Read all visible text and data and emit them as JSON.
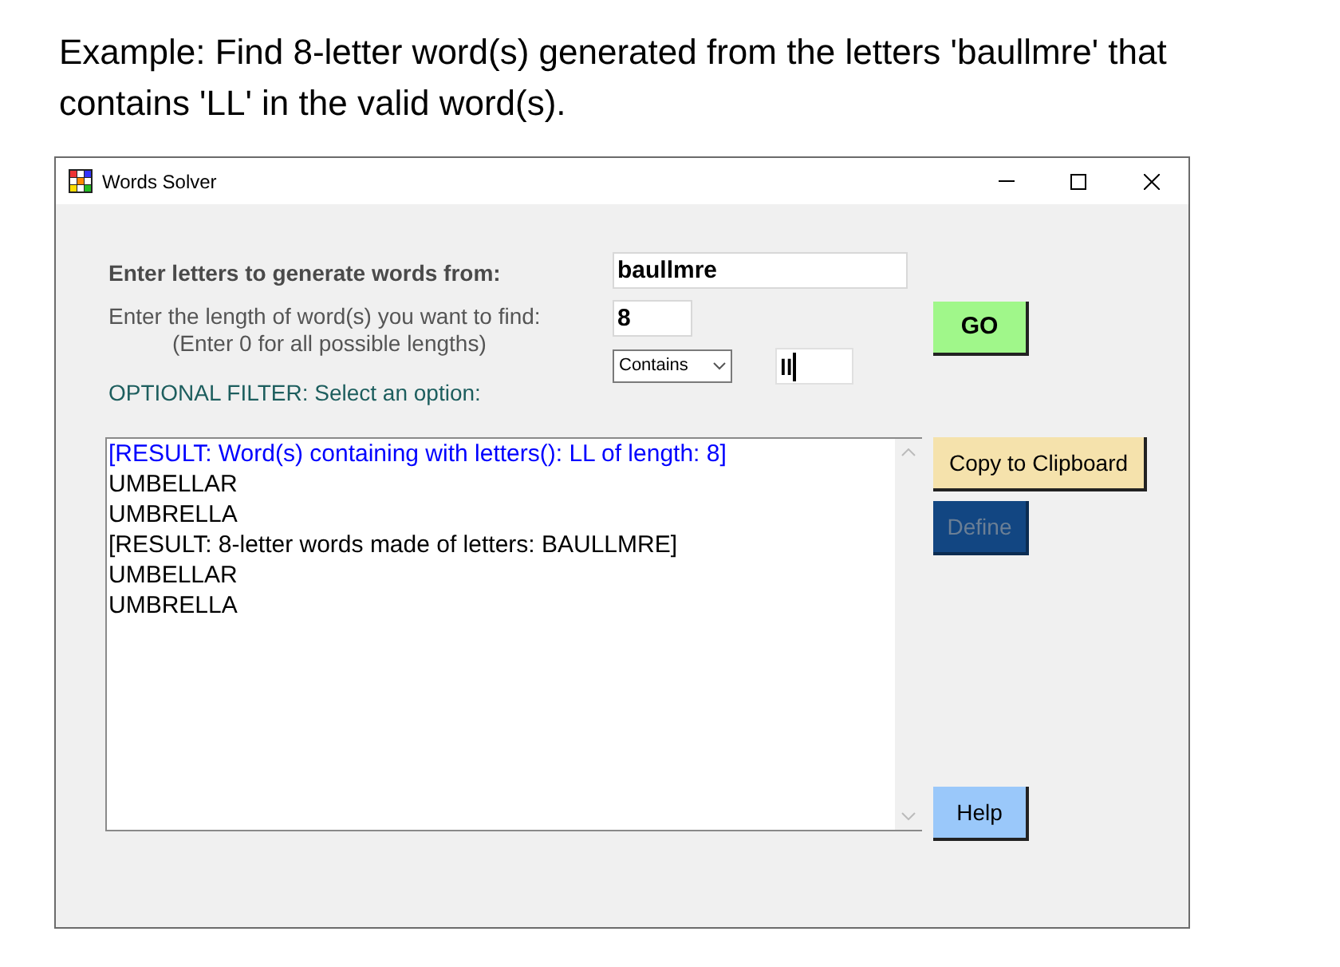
{
  "caption": "Example: Find 8-letter word(s) generated from the letters 'baullmre' that contains 'LL' in the valid word(s).",
  "window": {
    "title": "Words Solver"
  },
  "form": {
    "letters_label": "Enter letters to generate words from:",
    "letters_value": "baullmre",
    "length_label": "Enter the length of word(s) you want to find:",
    "length_hint": "(Enter 0 for all possible lengths)",
    "length_value": "8",
    "filter_label": "OPTIONAL FILTER: Select an option:",
    "filter_option": "Contains",
    "filter_value": "ll",
    "filter_focused": true
  },
  "results": [
    {
      "text": "[RESULT: Word(s) containing with letters(): LL of length: 8]",
      "highlighted": true
    },
    {
      "text": "UMBELLAR",
      "highlighted": false
    },
    {
      "text": "UMBRELLA",
      "highlighted": false
    },
    {
      "text": "[RESULT: 8-letter words made of letters: BAULLMRE]",
      "highlighted": false
    },
    {
      "text": "UMBELLAR",
      "highlighted": false
    },
    {
      "text": "UMBRELLA",
      "highlighted": false
    }
  ],
  "buttons": {
    "go": {
      "label": "GO"
    },
    "copy": {
      "label": "Copy to Clipboard"
    },
    "define": {
      "label": "Define",
      "disabled": true
    },
    "help": {
      "label": "Help"
    }
  }
}
